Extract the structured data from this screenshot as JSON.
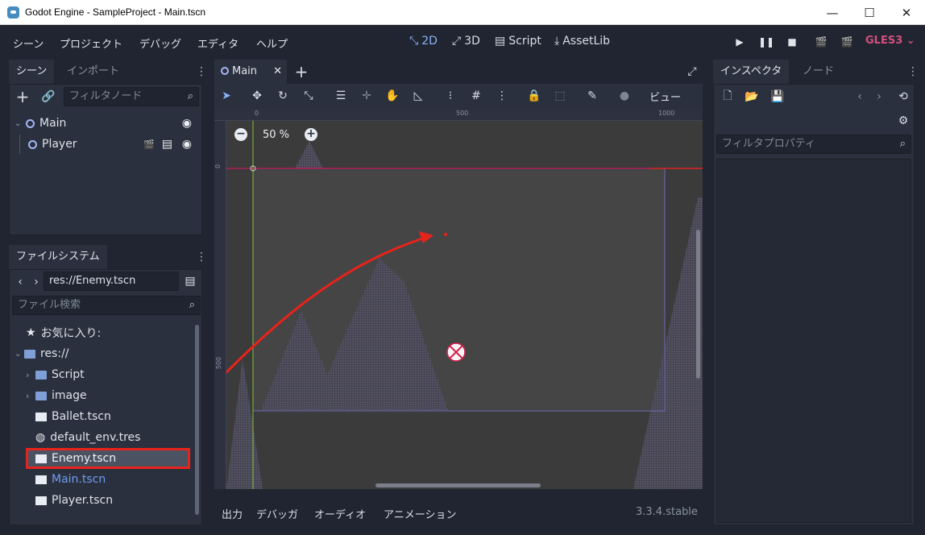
{
  "window": {
    "title": "Godot Engine - SampleProject - Main.tscn"
  },
  "menu": [
    "シーン",
    "プロジェクト",
    "デバッグ",
    "エディタ",
    "ヘルプ"
  ],
  "workspaces": {
    "w2d": "2D",
    "w3d": "3D",
    "script": "Script",
    "assetlib": "AssetLib"
  },
  "renderer": "GLES3",
  "scene_dock": {
    "tabs": [
      "シーン",
      "インポート"
    ],
    "filter_placeholder": "フィルタノード",
    "nodes": [
      {
        "name": "Main"
      },
      {
        "name": "Player"
      }
    ]
  },
  "filesystem": {
    "tab": "ファイルシステム",
    "path": "res://Enemy.tscn",
    "search_placeholder": "ファイル検索",
    "favorites": "お気に入り:",
    "root": "res://",
    "items": [
      {
        "name": "Script",
        "type": "folder"
      },
      {
        "name": "image",
        "type": "folder"
      },
      {
        "name": "Ballet.tscn",
        "type": "scene"
      },
      {
        "name": "default_env.tres",
        "type": "resource"
      },
      {
        "name": "Enemy.tscn",
        "type": "scene",
        "selected": true
      },
      {
        "name": "Main.tscn",
        "type": "scene",
        "current": true
      },
      {
        "name": "Player.tscn",
        "type": "scene"
      }
    ]
  },
  "editor": {
    "tab": "Main",
    "view_menu": "ビュー",
    "zoom": "50 %",
    "ruler_top": [
      "0",
      "500",
      "1000"
    ],
    "ruler_left": [
      "0",
      "500"
    ]
  },
  "inspector": {
    "tabs": [
      "インスペクタ",
      "ノード"
    ],
    "filter_placeholder": "フィルタプロパティ"
  },
  "bottom": {
    "tabs": [
      "出力",
      "デバッガ",
      "オーディオ",
      "アニメーション"
    ],
    "version": "3.3.4.stable"
  },
  "colors": {
    "accent": "#8ab4f8",
    "highlight": "#e8231b",
    "gles": "#d44f7c",
    "panel": "#2a303d"
  }
}
